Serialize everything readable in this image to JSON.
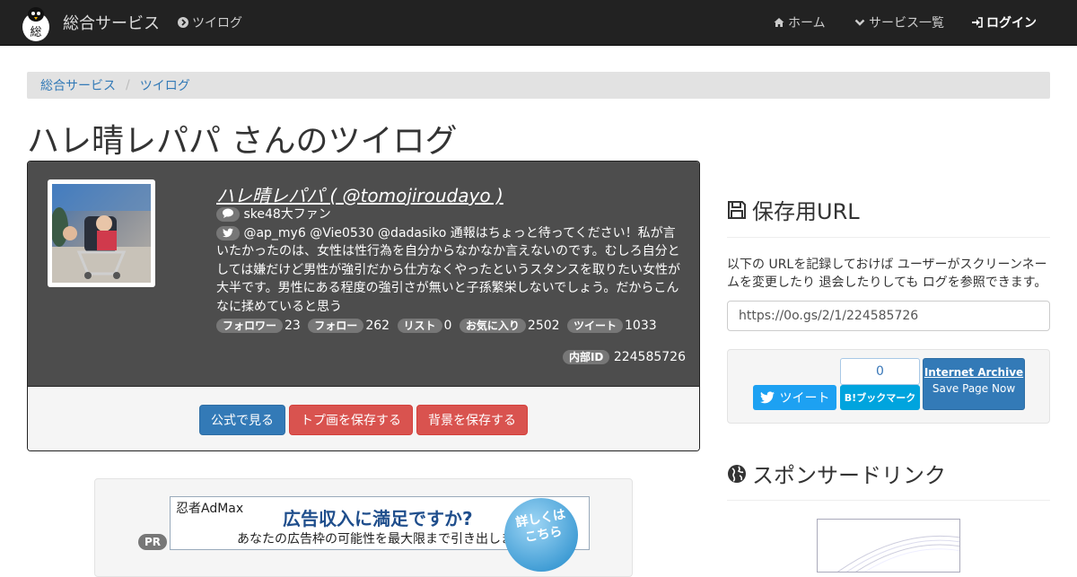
{
  "navbar": {
    "brand": "総合サービス",
    "service_link": "ツイログ",
    "home": "ホーム",
    "services": "サービス一覧",
    "login": "ログイン",
    "logo_char": "総"
  },
  "breadcrumb": {
    "root": "総合サービス",
    "sep": "/",
    "current": "ツイログ"
  },
  "title": "ハレ晴レパパ さんのツイログ",
  "profile": {
    "name_line": "ハレ晴レパパ ( @tomojiroudayo )",
    "bio": "ske48大ファン",
    "tweet": "@ap_my6 @Vie0530 @dadasiko 通報はちょっと待ってください！私が言いたかったのは、女性は性行為を自分からなかなか言えないのです。むしろ自分としては嫌だけど男性が強引だから仕方なくやったというスタンスを取りたい女性が大半です。男性にある程度の強引さが無いと子孫繁栄しないでしょう。だからこんなに揉めていると思う",
    "stats": [
      {
        "label": "フォロワー",
        "value": "23"
      },
      {
        "label": "フォロー",
        "value": "262"
      },
      {
        "label": "リスト",
        "value": "0"
      },
      {
        "label": "お気に入り",
        "value": "2502"
      },
      {
        "label": "ツイート",
        "value": "1033"
      }
    ],
    "internal_label": "内部ID",
    "internal_id": "224585726",
    "buttons": {
      "official": "公式で見る",
      "save_icon": "トプ画を保存する",
      "save_bg": "背景を保存する"
    }
  },
  "ad": {
    "pr": "PR",
    "brand": "忍者AdMax",
    "headline": "広告収入に満足ですか?",
    "sub": "あなたの広告枠の可能性を最大限まで引き出します",
    "cta": "詳しくはこちら"
  },
  "sidebar": {
    "save_heading": "保存用URL",
    "save_desc": "以下の URLを記録しておけば ユーザーがスクリーンネームを変更したり 退会したりしても ログを参照できます。",
    "url": "https://0o.gs/2/1/224585726",
    "tweet_btn": "ツイート",
    "hatena_count": "0",
    "hatena_btn": "B!ブックマーク",
    "ia_title": "Internet Archive",
    "ia_sub": "Save Page Now",
    "sponsor_heading": "スポンサードリンク"
  }
}
